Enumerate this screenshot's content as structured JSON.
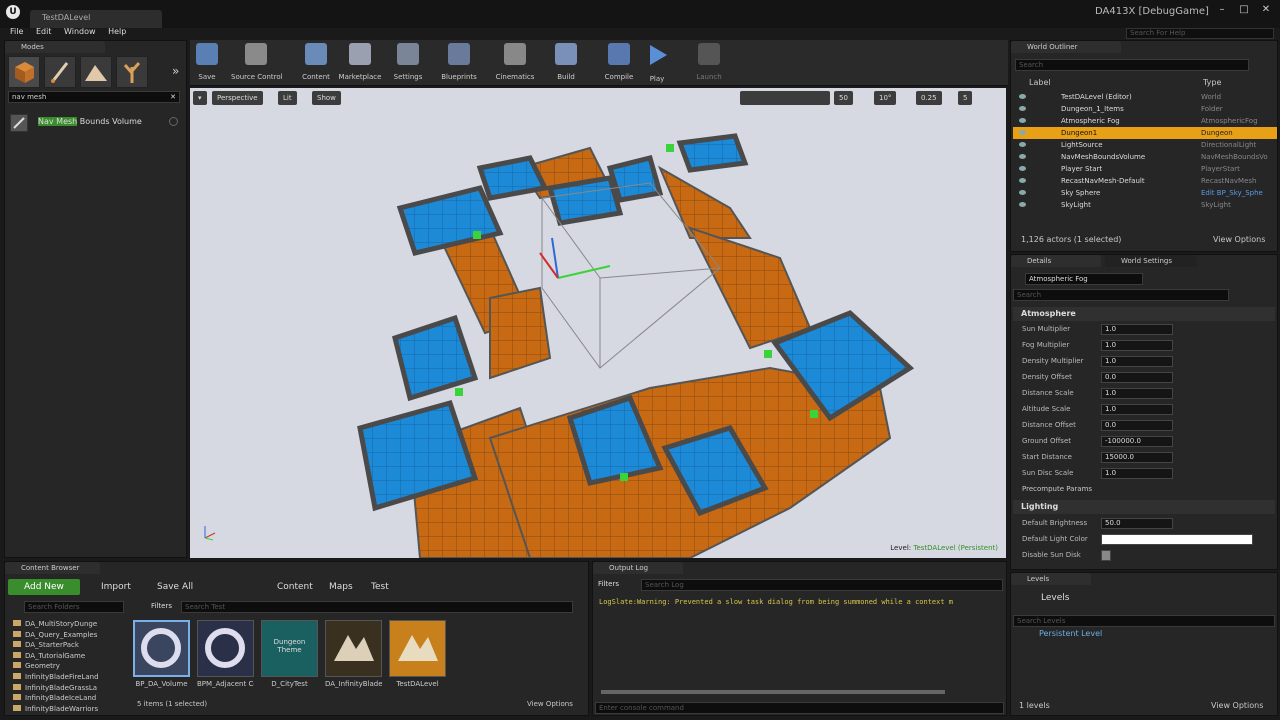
{
  "window": {
    "tab": "TestDALevel",
    "project": "DA413X [DebugGame]",
    "help_search": "Search For Help"
  },
  "menu": [
    "File",
    "Edit",
    "Window",
    "Help"
  ],
  "modes": {
    "title": "Modes",
    "search": "nav mesh",
    "result_highlight": "Nav Mesh",
    "result_rest": " Bounds Volume"
  },
  "toolbar": [
    "Save",
    "Source Control",
    "Content",
    "Marketplace",
    "Settings",
    "Blueprints",
    "Cinematics",
    "Build",
    "Compile",
    "Play",
    "Launch"
  ],
  "viewport": {
    "perspective": "Perspective",
    "lit": "Lit",
    "show": "Show",
    "grid": "50",
    "rot": "10°",
    "scale": "0.25",
    "cam": "5",
    "level_label": "Level:",
    "level_name": "TestDALevel (Persistent)"
  },
  "outliner": {
    "title": "World Outliner",
    "search": "Search",
    "col_label": "Label",
    "col_type": "Type",
    "rows": [
      {
        "name": "TestDALevel (Editor)",
        "type": "World"
      },
      {
        "name": "Dungeon_1_Items",
        "type": "Folder"
      },
      {
        "name": "Atmospheric Fog",
        "type": "AtmosphericFog"
      },
      {
        "name": "Dungeon1",
        "type": "Dungeon"
      },
      {
        "name": "LightSource",
        "type": "DirectionalLight"
      },
      {
        "name": "NavMeshBoundsVolume",
        "type": "NavMeshBoundsVo"
      },
      {
        "name": "Player Start",
        "type": "PlayerStart"
      },
      {
        "name": "RecastNavMesh-Default",
        "type": "RecastNavMesh"
      },
      {
        "name": "Sky Sphere",
        "type": "Edit BP_Sky_Sphe"
      },
      {
        "name": "SkyLight",
        "type": "SkyLight"
      }
    ],
    "footer": "1,126 actors (1 selected)",
    "view_options": "View Options"
  },
  "details": {
    "tab1": "Details",
    "tab2": "World Settings",
    "object": "Atmospheric Fog",
    "search": "Search",
    "atmosphere": "Atmosphere",
    "props": [
      {
        "label": "Sun Multiplier",
        "value": "1.0"
      },
      {
        "label": "Fog Multiplier",
        "value": "1.0"
      },
      {
        "label": "Density Multiplier",
        "value": "1.0"
      },
      {
        "label": "Density Offset",
        "value": "0.0"
      },
      {
        "label": "Distance Scale",
        "value": "1.0"
      },
      {
        "label": "Altitude Scale",
        "value": "1.0"
      },
      {
        "label": "Distance Offset",
        "value": "0.0"
      },
      {
        "label": "Ground Offset",
        "value": "-100000.0"
      },
      {
        "label": "Start Distance",
        "value": "15000.0"
      },
      {
        "label": "Sun Disc Scale",
        "value": "1.0"
      }
    ],
    "precompute": "Precompute Params",
    "lighting": "Lighting",
    "default_brightness_label": "Default Brightness",
    "default_brightness": "50.0",
    "default_light_color": "Default Light Color",
    "disable_sun_disk": "Disable Sun Disk"
  },
  "levels": {
    "title": "Levels",
    "header": "Levels",
    "search": "Search Levels",
    "persistent": "Persistent Level",
    "count": "1 levels",
    "view_options": "View Options"
  },
  "content": {
    "title": "Content Browser",
    "add_new": "Add New",
    "import": "Import",
    "save_all": "Save All",
    "path": [
      "Content",
      "Maps",
      "Test"
    ],
    "search_folders": "Search Folders",
    "filters": "Filters",
    "search": "Search Test",
    "folders": [
      "DA_MultiStoryDunge",
      "DA_Query_Examples",
      "DA_StarterPack",
      "DA_TutorialGame",
      "Geometry",
      "InfinityBladeFireLand",
      "InfinityBladeGrassLa",
      "InfinityBladeIceLand",
      "InfinityBladeWarriors"
    ],
    "assets": [
      "BP_DA_Volume",
      "BPM_Adjacent CellEmitter Coo",
      "D_CityTest",
      "DA_InfinityBlade",
      "TestDALevel"
    ],
    "theme_label": "Dungeon Theme",
    "footer": "5 items (1 selected)",
    "view_options": "View Options"
  },
  "output": {
    "title": "Output Log",
    "filters": "Filters",
    "search": "Search Log",
    "log": "LogSlate:Warning: Prevented a slow task dialog from being summoned while a context m",
    "console": "Enter console command"
  }
}
